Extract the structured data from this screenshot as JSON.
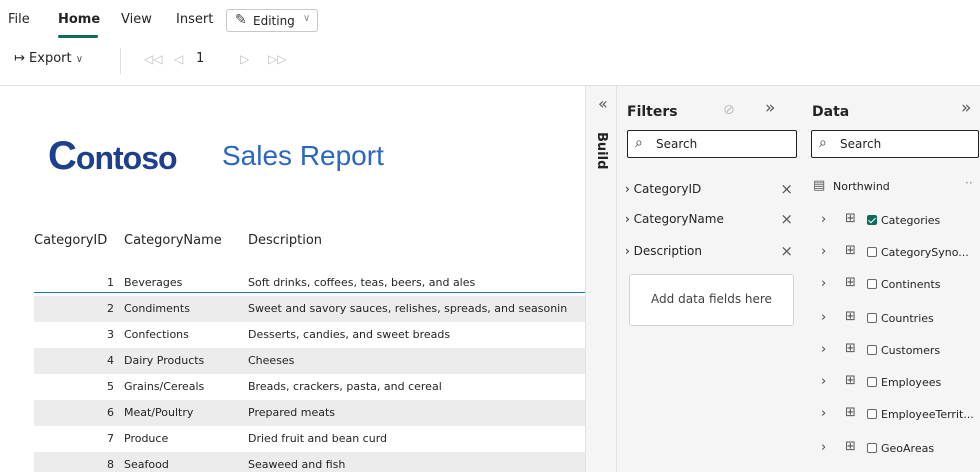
{
  "menu": {
    "file": "File",
    "home": "Home",
    "view": "View",
    "insert": "Insert",
    "editing": "Editing"
  },
  "toolbar": {
    "export": "Export",
    "page_number": "1"
  },
  "report": {
    "logo": "ontoso",
    "logo_initial": "C",
    "title": "Sales Report",
    "columns": [
      "CategoryID",
      "CategoryName",
      "Description"
    ],
    "rows": [
      {
        "id": "1",
        "name": "Beverages",
        "desc": "Soft drinks, coffees, teas, beers, and ales"
      },
      {
        "id": "2",
        "name": "Condiments",
        "desc": "Sweet and savory sauces, relishes, spreads, and seasonin"
      },
      {
        "id": "3",
        "name": "Confections",
        "desc": "Desserts, candies, and sweet breads"
      },
      {
        "id": "4",
        "name": "Dairy Products",
        "desc": "Cheeses"
      },
      {
        "id": "5",
        "name": "Grains/Cereals",
        "desc": "Breads, crackers, pasta, and cereal"
      },
      {
        "id": "6",
        "name": "Meat/Poultry",
        "desc": "Prepared meats"
      },
      {
        "id": "7",
        "name": "Produce",
        "desc": "Dried fruit and bean curd"
      },
      {
        "id": "8",
        "name": "Seafood",
        "desc": "Seaweed and fish"
      }
    ]
  },
  "build": {
    "label": "Build"
  },
  "filters": {
    "title": "Filters",
    "search_placeholder": "Search",
    "items": [
      "CategoryID",
      "CategoryName",
      "Description"
    ],
    "add_fields": "Add data fields here"
  },
  "data": {
    "title": "Data",
    "search_placeholder": "Search",
    "model": "Northwind",
    "tables": [
      {
        "name": "Categories",
        "checked": true
      },
      {
        "name": "CategorySyno...",
        "checked": false
      },
      {
        "name": "Continents",
        "checked": false
      },
      {
        "name": "Countries",
        "checked": false
      },
      {
        "name": "Customers",
        "checked": false
      },
      {
        "name": "Employees",
        "checked": false
      },
      {
        "name": "EmployeeTerrit...",
        "checked": false
      },
      {
        "name": "GeoAreas",
        "checked": false
      }
    ]
  },
  "colors": {
    "accent": "#0f6c5a",
    "title_blue": "#2a66c2",
    "logo_blue": "#1d3f8c",
    "row_alt": "#ececec"
  }
}
